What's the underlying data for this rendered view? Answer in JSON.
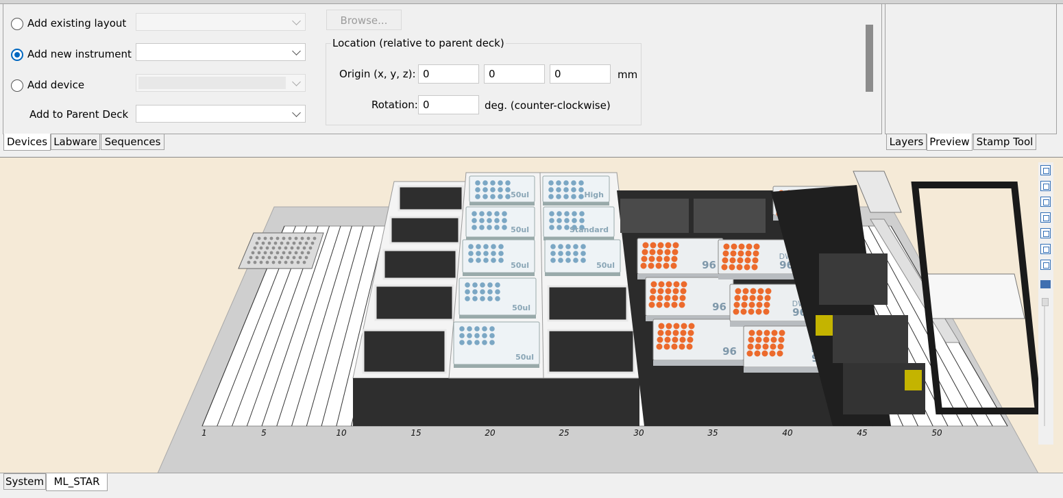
{
  "devices_panel": {
    "options": [
      {
        "label": "Add existing layout",
        "checked": false,
        "combo_value": "",
        "combo_enabled": false
      },
      {
        "label": "Add new instrument",
        "checked": true,
        "combo_value": "",
        "combo_enabled": true
      },
      {
        "label": "Add device",
        "checked": false,
        "combo_value": "",
        "combo_enabled": false
      }
    ],
    "parent_deck_label": "Add to Parent Deck",
    "parent_deck_value": "",
    "browse_label": "Browse...",
    "location": {
      "title": "Location (relative to parent deck)",
      "origin_label": "Origin (x, y, z):",
      "origin_x": "0",
      "origin_y": "0",
      "origin_z": "0",
      "origin_unit": "mm",
      "rotation_label": "Rotation:",
      "rotation_value": "0",
      "rotation_unit": "deg. (counter-clockwise)"
    },
    "tabs": [
      "Devices",
      "Labware",
      "Sequences"
    ],
    "active_tab": "Devices"
  },
  "right_panel": {
    "tabs": [
      "Layers",
      "Preview",
      "Stamp Tool"
    ],
    "active_tab": "Preview"
  },
  "deck": {
    "track_labels": [
      "1",
      "5",
      "10",
      "15",
      "20",
      "25",
      "30",
      "35",
      "40",
      "45",
      "50"
    ],
    "tip_labels_col1": [
      "50ul",
      "50ul",
      "50ul",
      "50ul",
      "50ul"
    ],
    "tip_labels_col2": [
      "High",
      "Standard",
      "50ul"
    ],
    "plate_labels_col1": [
      "96",
      "96",
      "96"
    ],
    "plate_labels_col2": [
      "DW 96",
      "DW 96",
      "DW 96",
      "DW 96"
    ],
    "colors": {
      "background": "#f5ead7",
      "deck": "#c8c8c8",
      "carrier": "#2d2d2d",
      "tip": "#7ba7c4",
      "well": "#ec6a2c"
    }
  },
  "bottom_tabs": [
    "System",
    "ML_STAR"
  ],
  "active_bottom_tab": "ML_STAR"
}
